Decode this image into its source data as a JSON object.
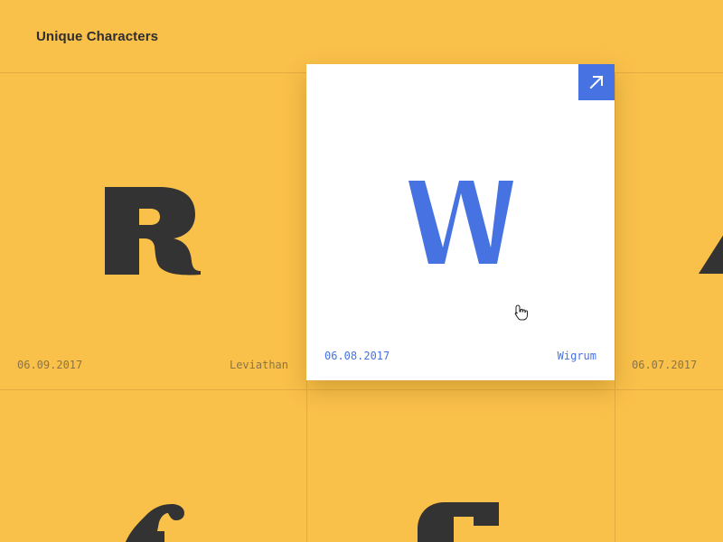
{
  "header": {
    "title": "Unique Characters"
  },
  "colors": {
    "background": "#F9C04A",
    "glyph": "#333333",
    "accent": "#4772E2",
    "card": "#FFFFFF"
  },
  "tiles": [
    {
      "glyph": "R",
      "date": "06.09.2017",
      "font": "Leviathan"
    },
    {
      "glyph": "W",
      "date": "06.08.2017",
      "font": "Wigrum",
      "highlighted": true,
      "action_icon": "arrow-up-right-icon"
    },
    {
      "glyph": "A",
      "date": "06.07.2017"
    },
    {
      "glyph": "f"
    },
    {
      "glyph": "G"
    }
  ]
}
